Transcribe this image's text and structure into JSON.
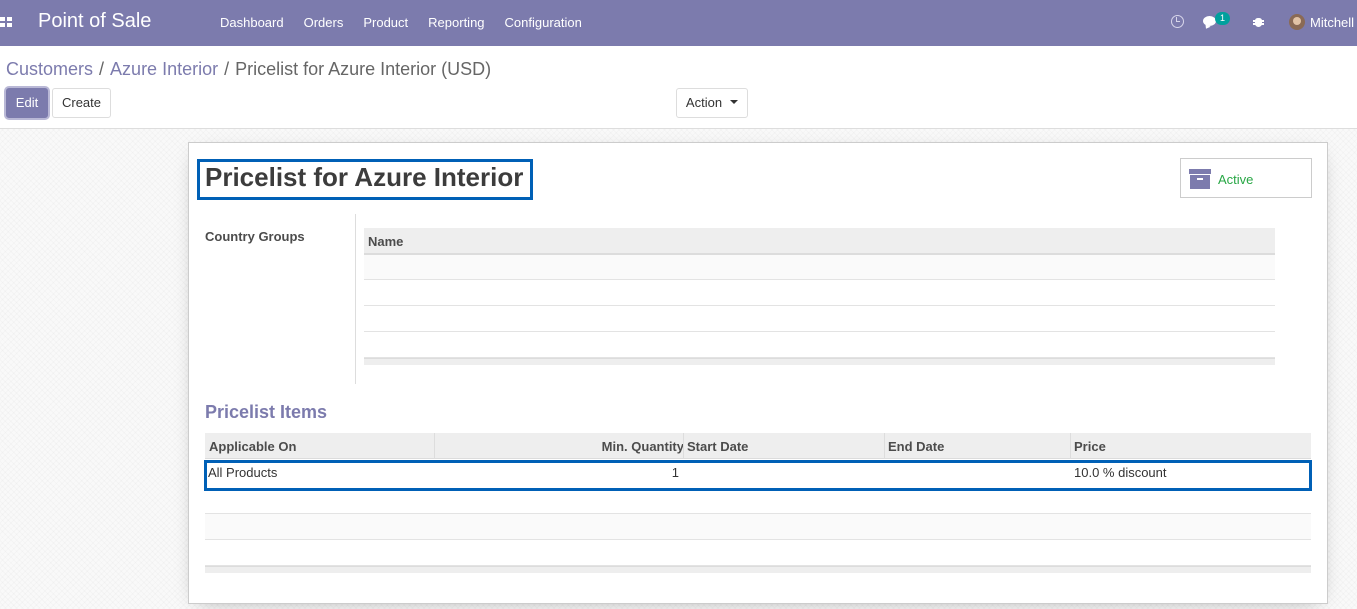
{
  "navbar": {
    "app_title": "Point of Sale",
    "menu": [
      "Dashboard",
      "Orders",
      "Product",
      "Reporting",
      "Configuration"
    ],
    "chat_count": "1",
    "user_name": "Mitchell",
    "bar_color": "#7c7bad"
  },
  "breadcrumb": {
    "items": [
      "Customers",
      "Azure Interior"
    ],
    "current": "Pricelist for Azure Interior (USD)",
    "separator": "/"
  },
  "toolbar": {
    "edit_label": "Edit",
    "create_label": "Create",
    "action_label": "Action"
  },
  "form": {
    "title": "Pricelist for Azure Interior",
    "status_label": "Active",
    "country_groups_label": "Country Groups",
    "country_groups_columns": [
      "Name"
    ],
    "pricelist_items_title": "Pricelist Items",
    "pricelist_columns": [
      "Applicable On",
      "Min. Quantity",
      "Start Date",
      "End Date",
      "Price"
    ],
    "pricelist_rows": [
      {
        "applicable_on": "All Products",
        "min_quantity": "1",
        "start_date": "",
        "end_date": "",
        "price": "10.0 % discount"
      }
    ]
  },
  "colors": {
    "accent": "#7c7bad",
    "highlight": "#0060b6",
    "active_green": "#28a745"
  }
}
